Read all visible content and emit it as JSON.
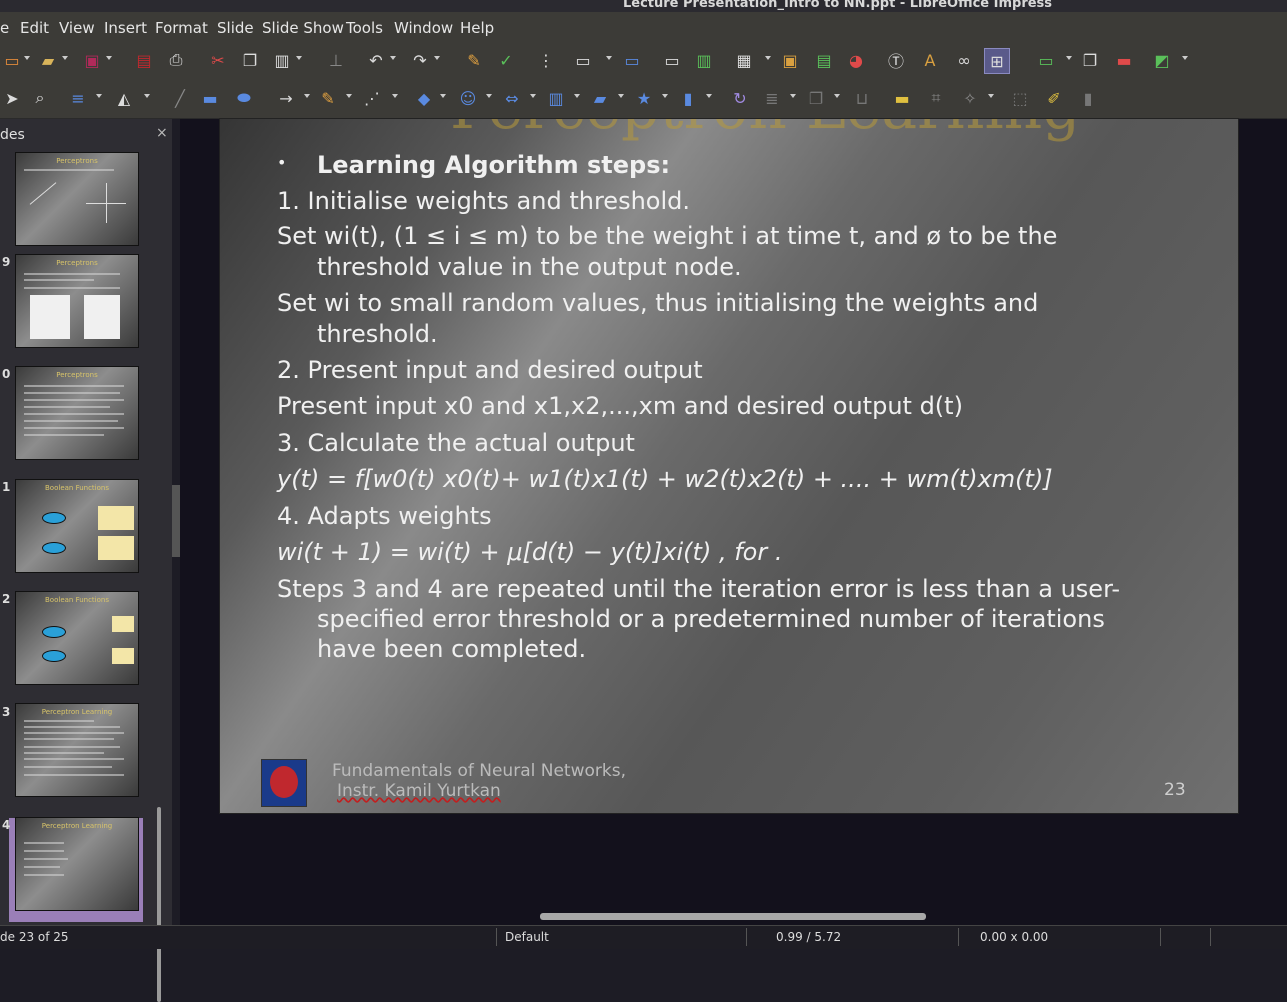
{
  "window_title": "Lecture Presentation_Intro to NN.ppt - LibreOffice Impress",
  "menu": [
    "e",
    "Edit",
    "View",
    "Insert",
    "Format",
    "Slide",
    "Slide Show",
    "Tools",
    "Window",
    "Help"
  ],
  "slides_pane": {
    "header": "des",
    "close": "×",
    "thumbs": [
      {
        "num": "",
        "title": "Perceptrons"
      },
      {
        "num": "9",
        "title": "Perceptrons"
      },
      {
        "num": "0",
        "title": "Perceptrons"
      },
      {
        "num": "1",
        "title": "Boolean Functions"
      },
      {
        "num": "2",
        "title": "Boolean Functions"
      },
      {
        "num": "3",
        "title": "Perceptron Learning"
      },
      {
        "num": "4",
        "title": "Perceptron Learning"
      }
    ]
  },
  "slide": {
    "ghost_title": "Perceptron Learning",
    "bullet": "•",
    "heading": "Learning Algorithm steps:",
    "lines": [
      "1. Initialise weights and threshold.",
      "Set wi(t), (1 ≤ i ≤ m) to be the weight i at time t, and ø to be the",
      "threshold value in the output node.",
      "Set wi to small random values, thus initialising the weights and",
      "threshold.",
      "2. Present input and desired output",
      "Present input x0 and x1,x2,...,xm and desired output d(t)",
      "3. Calculate the actual output",
      "y(t) = f[w0(t) x0(t)+ w1(t)x1(t) + w2(t)x2(t) + .... + wm(t)xm(t)]",
      "4. Adapts weights",
      "wi(t + 1) = wi(t) + μ[d(t) − y(t)]xi(t) , for .",
      "Steps 3 and 4 are repeated until the iteration error is less than a user-",
      "specified error threshold or a predetermined number of iterations",
      "have been completed."
    ],
    "footer_line1": "Fundamentals of Neural Networks,",
    "footer_line2": "Instr. Kamil Yurtkan",
    "page_number": "23"
  },
  "statusbar": {
    "slide_info": "de 23 of 25",
    "layout": "Default",
    "position": "0.99 / 5.72",
    "size": "0.00 x 0.00"
  }
}
